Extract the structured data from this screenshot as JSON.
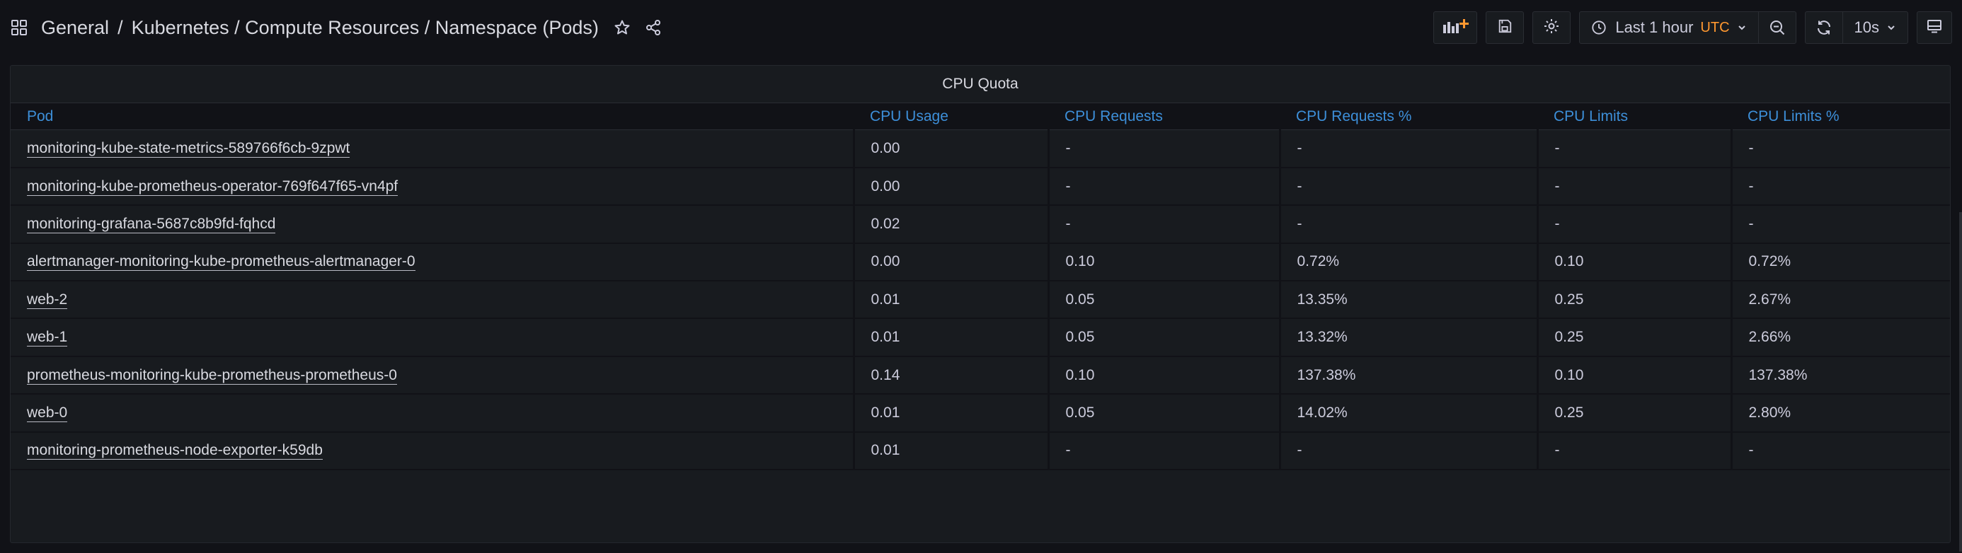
{
  "breadcrumb": {
    "folder": "General",
    "separator": "/",
    "title": "Kubernetes / Compute Resources / Namespace (Pods)"
  },
  "toolbar": {
    "time_range": "Last 1 hour",
    "timezone": "UTC",
    "refresh_interval": "10s"
  },
  "icons": {
    "apps": "apps-icon",
    "star": "star-icon",
    "share": "share-icon",
    "add_panel": "add-panel-icon",
    "save": "save-icon",
    "settings": "gear-icon",
    "clock": "clock-icon",
    "zoom_out": "zoom-out-icon",
    "refresh": "refresh-icon",
    "tv": "tv-mode-icon"
  },
  "colors": {
    "background": "#111217",
    "panel": "#181b1f",
    "header_link": "#3d8fd9",
    "utc_accent": "#ff9830",
    "add_panel_accent": "#ff9830"
  },
  "panel": {
    "title": "CPU Quota",
    "columns": [
      "Pod",
      "CPU Usage",
      "CPU Requests",
      "CPU Requests %",
      "CPU Limits",
      "CPU Limits %"
    ],
    "rows": [
      [
        "monitoring-kube-state-metrics-589766f6cb-9zpwt",
        "0.00",
        "-",
        "-",
        "-",
        "-"
      ],
      [
        "monitoring-kube-prometheus-operator-769f647f65-vn4pf",
        "0.00",
        "-",
        "-",
        "-",
        "-"
      ],
      [
        "monitoring-grafana-5687c8b9fd-fqhcd",
        "0.02",
        "-",
        "-",
        "-",
        "-"
      ],
      [
        "alertmanager-monitoring-kube-prometheus-alertmanager-0",
        "0.00",
        "0.10",
        "0.72%",
        "0.10",
        "0.72%"
      ],
      [
        "web-2",
        "0.01",
        "0.05",
        "13.35%",
        "0.25",
        "2.67%"
      ],
      [
        "web-1",
        "0.01",
        "0.05",
        "13.32%",
        "0.25",
        "2.66%"
      ],
      [
        "prometheus-monitoring-kube-prometheus-prometheus-0",
        "0.14",
        "0.10",
        "137.38%",
        "0.10",
        "137.38%"
      ],
      [
        "web-0",
        "0.01",
        "0.05",
        "14.02%",
        "0.25",
        "2.80%"
      ],
      [
        "monitoring-prometheus-node-exporter-k59db",
        "0.01",
        "-",
        "-",
        "-",
        "-"
      ]
    ]
  }
}
